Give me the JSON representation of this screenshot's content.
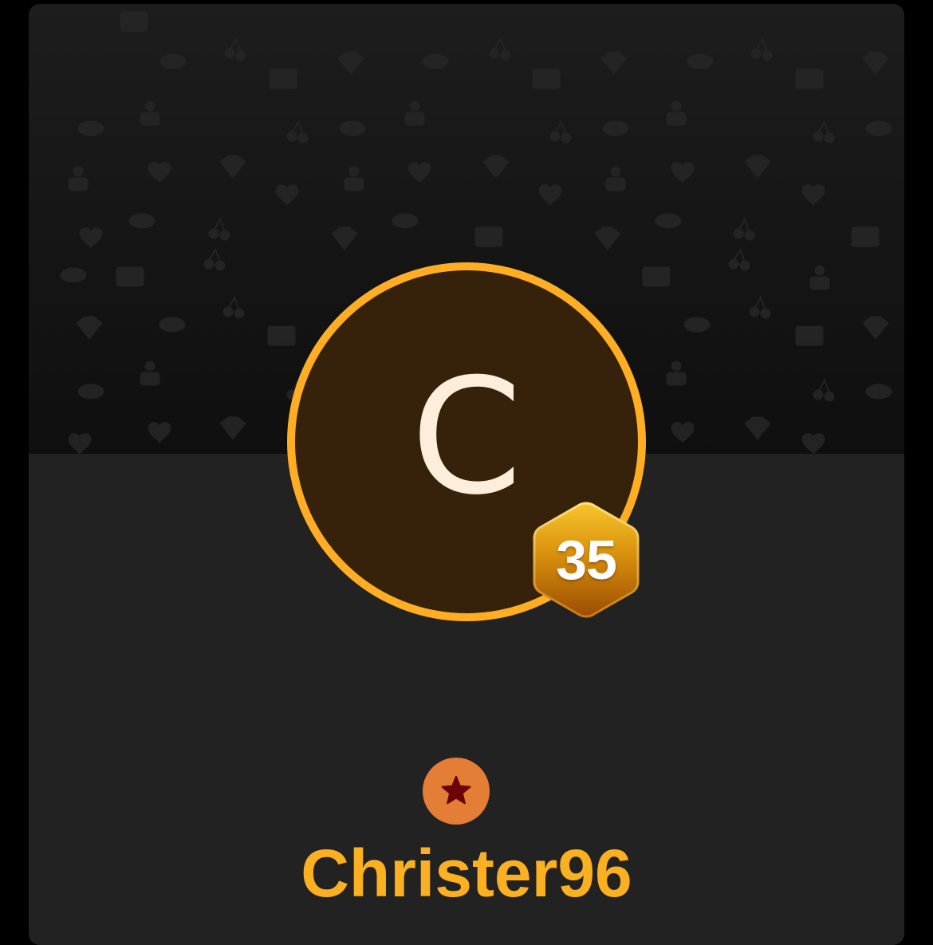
{
  "profile": {
    "avatar_initial": "C",
    "level": "35",
    "username": "Christer96"
  },
  "icons": {
    "banner": "pattern-background",
    "rank": "star-icon"
  },
  "colors": {
    "accent": "#ffae24",
    "username": "#fbb022",
    "avatar_fill": "#36220a",
    "avatar_letter": "#fdeedb",
    "rank_badge": "#e47d35",
    "rank_star": "#6b0505",
    "card_bg": "#222222"
  }
}
